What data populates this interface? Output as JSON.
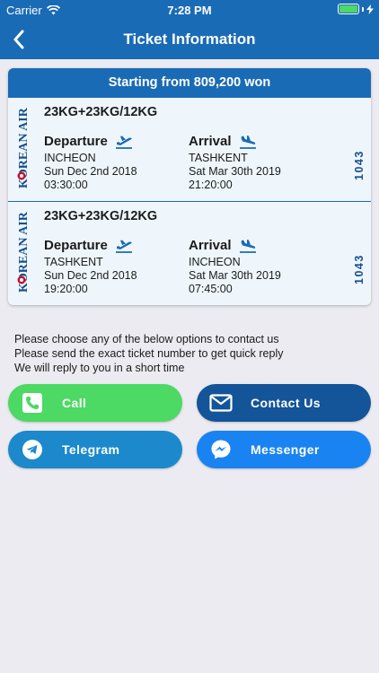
{
  "status_bar": {
    "carrier": "Carrier",
    "time": "7:28 PM"
  },
  "nav": {
    "title": "Ticket Information"
  },
  "card": {
    "header": "Starting from 809,200 won",
    "airline_logo_text": "KOREAN AIR",
    "flights": [
      {
        "baggage": "23KG+23KG/12KG",
        "departure_label": "Departure",
        "arrival_label": "Arrival",
        "departure_city": "INCHEON",
        "departure_date": "Sun Dec 2nd 2018",
        "departure_time": "03:30:00",
        "arrival_city": "TASHKENT",
        "arrival_date": "Sat Mar 30th 2019",
        "arrival_time": "21:20:00",
        "flight_number": "1043"
      },
      {
        "baggage": "23KG+23KG/12KG",
        "departure_label": "Departure",
        "arrival_label": "Arrival",
        "departure_city": "TASHKENT",
        "departure_date": "Sun Dec 2nd 2018",
        "departure_time": "19:20:00",
        "arrival_city": "INCHEON",
        "arrival_date": "Sat Mar 30th 2019",
        "arrival_time": "07:45:00",
        "flight_number": "1043"
      }
    ]
  },
  "info": {
    "line1": "Please choose any of the below options to contact us",
    "line2": "Please send the exact ticket number to get quick reply",
    "line3": "We will reply to you in a short time"
  },
  "buttons": {
    "call": "Call",
    "contact": "Contact Us",
    "telegram": "Telegram",
    "messenger": "Messenger"
  },
  "colors": {
    "primary": "#1a6bb5",
    "call": "#4cd964",
    "contact": "#145499",
    "telegram": "#1b89cc",
    "messenger": "#1a83f2",
    "logo_red": "#c8102e"
  },
  "icons": [
    "wifi-icon",
    "battery-icon",
    "back-chevron-icon",
    "takeoff-icon",
    "landing-icon",
    "phone-icon",
    "mail-icon",
    "telegram-icon",
    "messenger-icon"
  ]
}
